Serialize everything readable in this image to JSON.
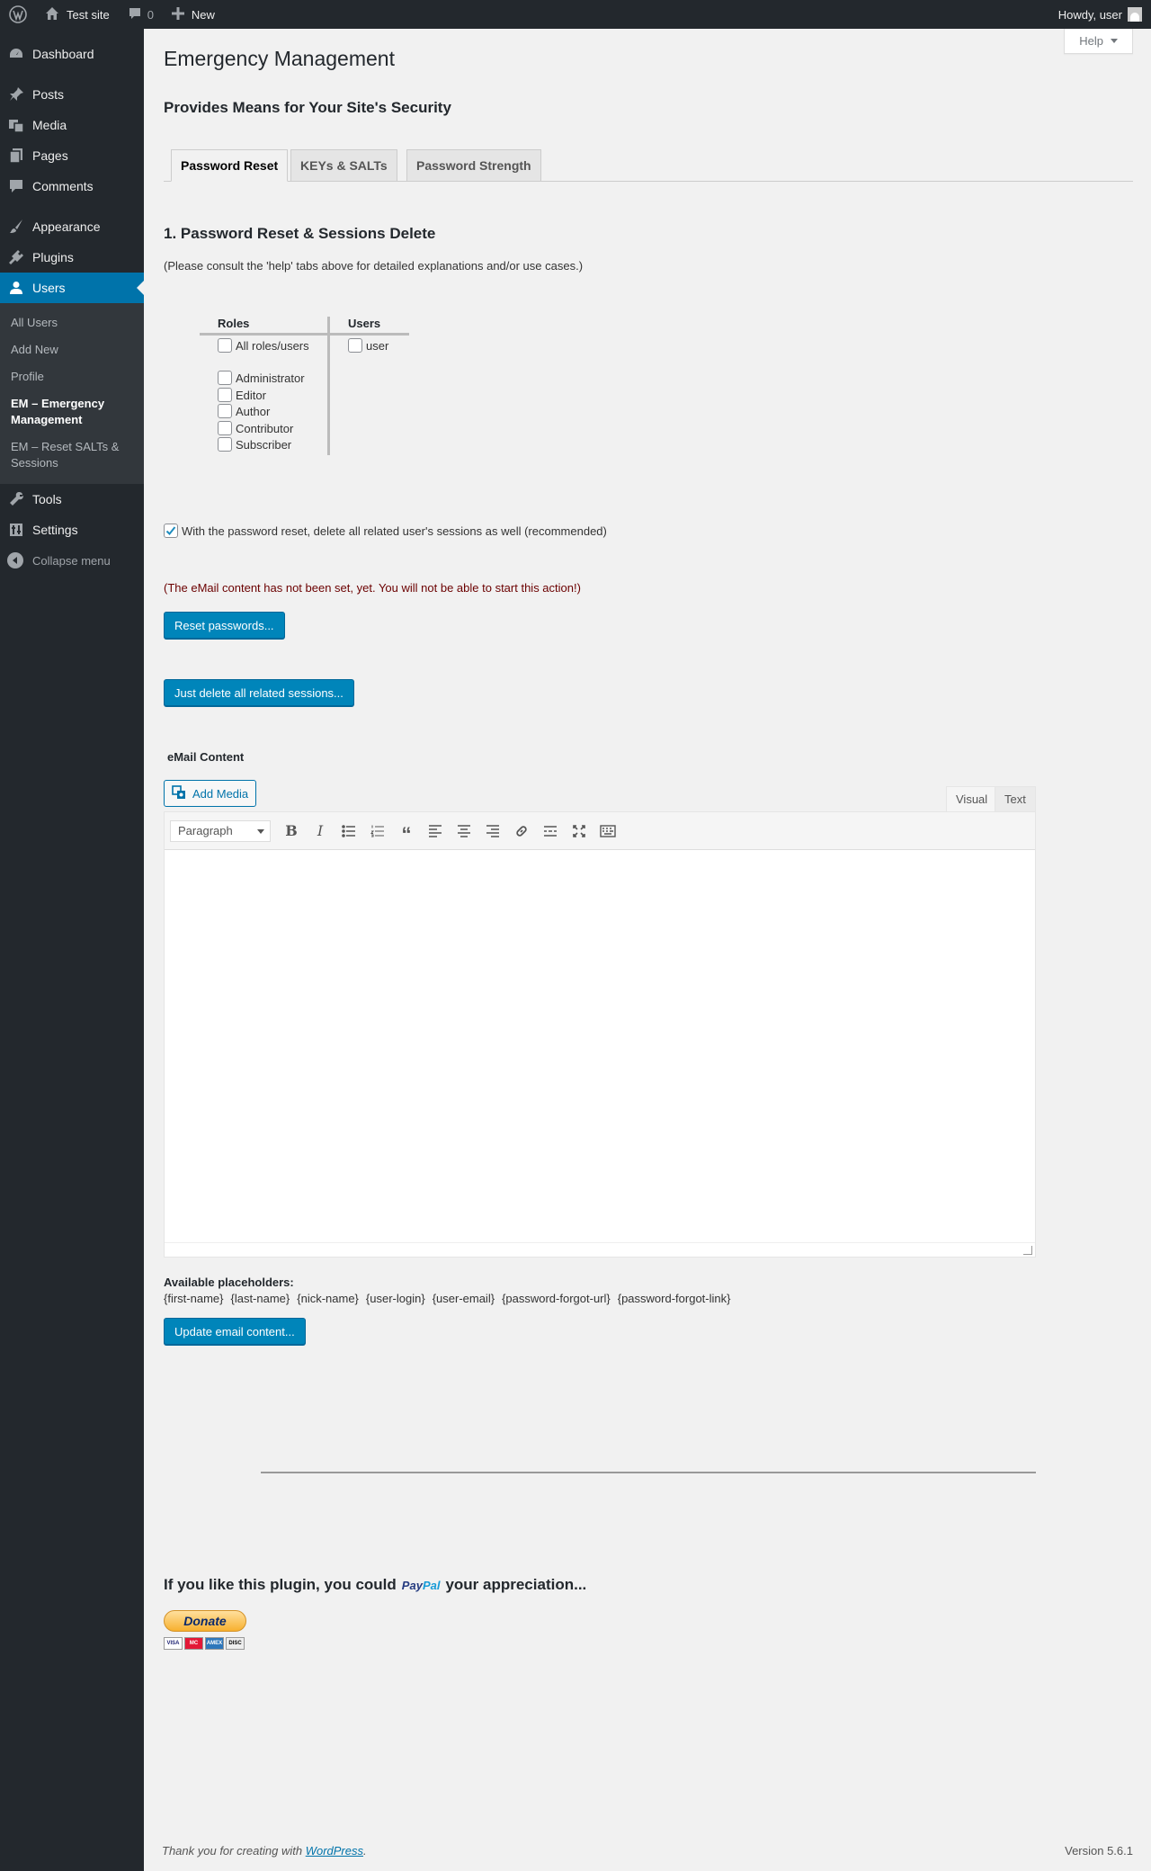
{
  "adminbar": {
    "site_name": "Test site",
    "comments_count": "0",
    "new_label": "New",
    "howdy": "Howdy, user"
  },
  "sidebar": {
    "items": [
      {
        "label": "Dashboard",
        "icon": "dashboard-icon"
      },
      {
        "label": "Posts",
        "icon": "pin-icon"
      },
      {
        "label": "Media",
        "icon": "media-icon"
      },
      {
        "label": "Pages",
        "icon": "pages-icon"
      },
      {
        "label": "Comments",
        "icon": "comment-icon"
      },
      {
        "label": "Appearance",
        "icon": "brush-icon"
      },
      {
        "label": "Plugins",
        "icon": "plugin-icon"
      },
      {
        "label": "Users",
        "icon": "user-icon"
      },
      {
        "label": "Tools",
        "icon": "wrench-icon"
      },
      {
        "label": "Settings",
        "icon": "settings-icon"
      }
    ],
    "users_submenu": [
      "All Users",
      "Add New",
      "Profile",
      "EM – Emergency Management",
      "EM – Reset SALTs & Sessions"
    ],
    "collapse": "Collapse menu"
  },
  "header": {
    "help": "Help",
    "title": "Emergency Management",
    "subtitle": "Provides Means for Your Site's Security"
  },
  "tabs": [
    "Password Reset",
    "KEYs & SALTs",
    "Password Strength"
  ],
  "section": {
    "title": "1. Password Reset & Sessions Delete",
    "hint": "(Please consult the 'help' tabs above for detailed explanations and/or use cases.)",
    "roles_header": "Roles",
    "users_header": "Users",
    "all_roles": "All roles/users",
    "roles": [
      "Administrator",
      "Editor",
      "Author",
      "Contributor",
      "Subscriber"
    ],
    "users": [
      "user"
    ],
    "sessions_checkbox": "With the password reset, delete all related user's sessions as well (recommended)",
    "warning": "(The eMail content has not been set, yet. You will not be able to start this action!)",
    "reset_button": "Reset passwords...",
    "delete_sessions_button": "Just delete all related sessions..."
  },
  "email": {
    "label": "eMail Content",
    "add_media": "Add Media",
    "tab_visual": "Visual",
    "tab_text": "Text",
    "format": "Paragraph",
    "placeholders_label": "Available placeholders:",
    "placeholders": [
      "{first-name}",
      "{last-name}",
      "{nick-name}",
      "{user-login}",
      "{user-email}",
      "{password-forgot-url}",
      "{password-forgot-link}"
    ],
    "update_button": "Update email content..."
  },
  "donation": {
    "text_before": "If you like this plugin, you could",
    "paypal_a": "Pay",
    "paypal_b": "Pal",
    "text_after": "your appreciation...",
    "donate": "Donate",
    "cards": [
      "VISA",
      "MC",
      "AMEX",
      "DISC"
    ]
  },
  "footer": {
    "thanks_prefix": "Thank you for creating with ",
    "thanks_link": "WordPress",
    "thanks_suffix": ".",
    "version": "Version 5.6.1"
  },
  "colors": {
    "admin_bg": "#23282d",
    "active_blue": "#0073aa",
    "button_blue": "#0085ba",
    "warning": "#6b0000"
  }
}
